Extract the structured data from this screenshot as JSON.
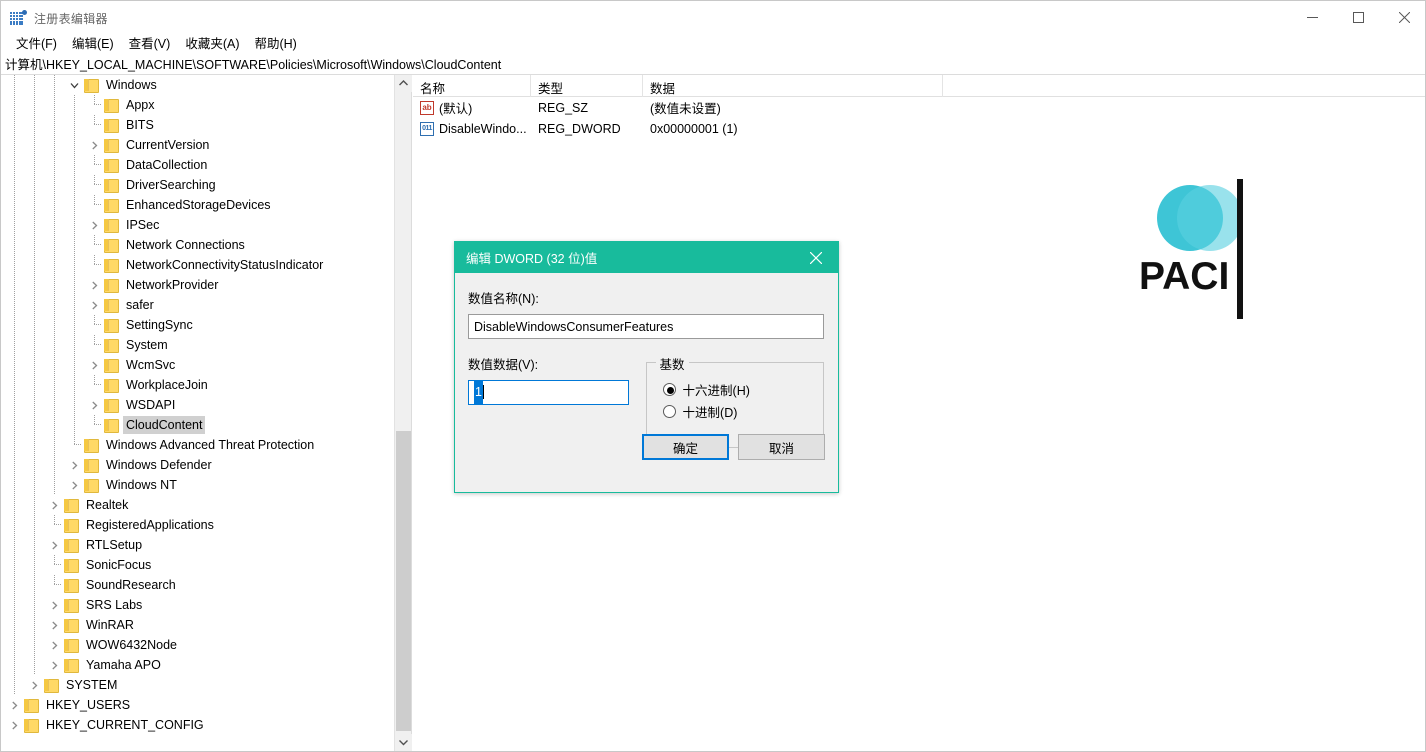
{
  "window": {
    "title": "注册表编辑器",
    "icon": "registry-icon",
    "controls": {
      "minimize": "–",
      "maximize": "□",
      "close": "✕"
    }
  },
  "menu": [
    {
      "label": "文件(F)",
      "name": "menu-file"
    },
    {
      "label": "编辑(E)",
      "name": "menu-edit"
    },
    {
      "label": "查看(V)",
      "name": "menu-view"
    },
    {
      "label": "收藏夹(A)",
      "name": "menu-favorites"
    },
    {
      "label": "帮助(H)",
      "name": "menu-help"
    }
  ],
  "address": {
    "path": "计算机\\HKEY_LOCAL_MACHINE\\SOFTWARE\\Policies\\Microsoft\\Windows\\CloudContent"
  },
  "tree": {
    "items": [
      {
        "label": "Windows",
        "indent": 4,
        "expander": "expanded",
        "selected": false
      },
      {
        "label": "Appx",
        "indent": 5,
        "expander": "none",
        "selected": false
      },
      {
        "label": "BITS",
        "indent": 5,
        "expander": "none",
        "selected": false
      },
      {
        "label": "CurrentVersion",
        "indent": 5,
        "expander": "collapsed",
        "selected": false
      },
      {
        "label": "DataCollection",
        "indent": 5,
        "expander": "none",
        "selected": false
      },
      {
        "label": "DriverSearching",
        "indent": 5,
        "expander": "none",
        "selected": false
      },
      {
        "label": "EnhancedStorageDevices",
        "indent": 5,
        "expander": "none",
        "selected": false
      },
      {
        "label": "IPSec",
        "indent": 5,
        "expander": "collapsed",
        "selected": false
      },
      {
        "label": "Network Connections",
        "indent": 5,
        "expander": "none",
        "selected": false
      },
      {
        "label": "NetworkConnectivityStatusIndicator",
        "indent": 5,
        "expander": "none",
        "selected": false
      },
      {
        "label": "NetworkProvider",
        "indent": 5,
        "expander": "collapsed",
        "selected": false
      },
      {
        "label": "safer",
        "indent": 5,
        "expander": "collapsed",
        "selected": false
      },
      {
        "label": "SettingSync",
        "indent": 5,
        "expander": "none",
        "selected": false
      },
      {
        "label": "System",
        "indent": 5,
        "expander": "none",
        "selected": false
      },
      {
        "label": "WcmSvc",
        "indent": 5,
        "expander": "collapsed",
        "selected": false
      },
      {
        "label": "WorkplaceJoin",
        "indent": 5,
        "expander": "none",
        "selected": false
      },
      {
        "label": "WSDAPI",
        "indent": 5,
        "expander": "collapsed",
        "selected": false
      },
      {
        "label": "CloudContent",
        "indent": 5,
        "expander": "none",
        "selected": true
      },
      {
        "label": "Windows Advanced Threat Protection",
        "indent": 4,
        "expander": "none",
        "selected": false
      },
      {
        "label": "Windows Defender",
        "indent": 4,
        "expander": "collapsed",
        "selected": false
      },
      {
        "label": "Windows NT",
        "indent": 4,
        "expander": "collapsed",
        "selected": false
      },
      {
        "label": "Realtek",
        "indent": 3,
        "expander": "collapsed",
        "selected": false
      },
      {
        "label": "RegisteredApplications",
        "indent": 3,
        "expander": "none",
        "selected": false
      },
      {
        "label": "RTLSetup",
        "indent": 3,
        "expander": "collapsed",
        "selected": false
      },
      {
        "label": "SonicFocus",
        "indent": 3,
        "expander": "none",
        "selected": false
      },
      {
        "label": "SoundResearch",
        "indent": 3,
        "expander": "none",
        "selected": false
      },
      {
        "label": "SRS Labs",
        "indent": 3,
        "expander": "collapsed",
        "selected": false
      },
      {
        "label": "WinRAR",
        "indent": 3,
        "expander": "collapsed",
        "selected": false
      },
      {
        "label": "WOW6432Node",
        "indent": 3,
        "expander": "collapsed",
        "selected": false
      },
      {
        "label": "Yamaha APO",
        "indent": 3,
        "expander": "collapsed",
        "selected": false
      },
      {
        "label": "SYSTEM",
        "indent": 2,
        "expander": "collapsed",
        "selected": false
      },
      {
        "label": "HKEY_USERS",
        "indent": 1,
        "expander": "collapsed",
        "selected": false
      },
      {
        "label": "HKEY_CURRENT_CONFIG",
        "indent": 1,
        "expander": "collapsed",
        "selected": false
      }
    ]
  },
  "list": {
    "columns": [
      "名称",
      "类型",
      "数据",
      ""
    ],
    "rows": [
      {
        "icon": "string-value-icon",
        "name": "(默认)",
        "type": "REG_SZ",
        "data": "(数值未设置)"
      },
      {
        "icon": "dword-value-icon",
        "name": "DisableWindo...",
        "type": "REG_DWORD",
        "data": "0x00000001 (1)"
      }
    ]
  },
  "watermark": {
    "text": "PACI",
    "circle_dark": "#3ec5d6",
    "circle_light": "#5ad1e0",
    "bar_color": "#111111"
  },
  "dialog": {
    "title": "编辑 DWORD (32 位)值",
    "close_label": "✕",
    "name_label": "数值名称(N):",
    "name_value": "DisableWindowsConsumerFeatures",
    "data_label": "数值数据(V):",
    "data_value": "1",
    "base_group_label": "基数",
    "radios": [
      {
        "label": "十六进制(H)",
        "checked": true
      },
      {
        "label": "十进制(D)",
        "checked": false
      }
    ],
    "ok_label": "确定",
    "cancel_label": "取消",
    "accent_color": "#18bb9c"
  }
}
